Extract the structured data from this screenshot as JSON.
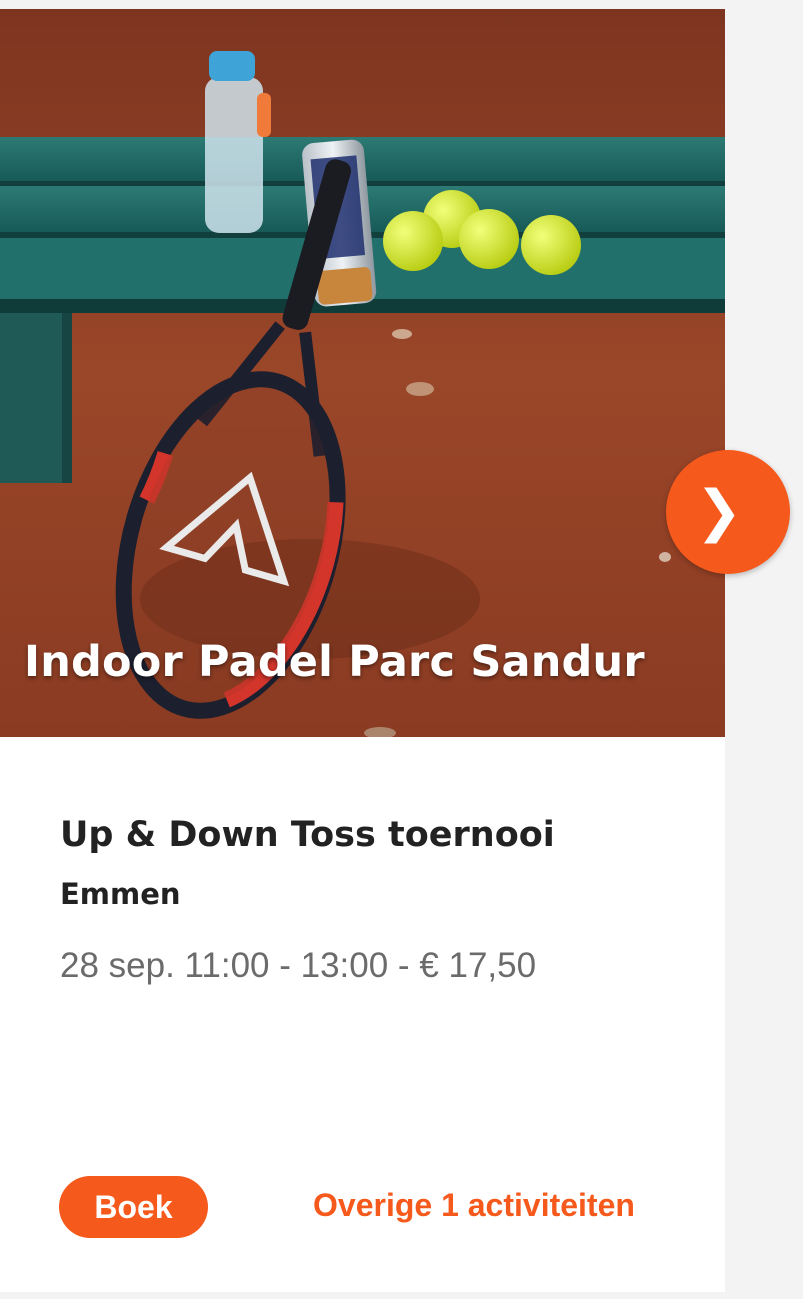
{
  "hero": {
    "image_alt": "tennis racket leaning against green bench with tennis balls on clay court",
    "location_title": "Indoor Padel Parc Sandur"
  },
  "carousel": {
    "next_icon": "chevron-right-icon",
    "next_glyph": "❯"
  },
  "event": {
    "title": "Up & Down Toss toernooi",
    "city": "Emmen",
    "meta": "28 sep. 11:00 - 13:00 - € 17,50"
  },
  "actions": {
    "book_label": "Boek",
    "more_label": "Overige 1 activiteiten"
  },
  "colors": {
    "accent": "#f6591c",
    "title_text": "#222222",
    "meta_text": "#6b6b6b"
  }
}
